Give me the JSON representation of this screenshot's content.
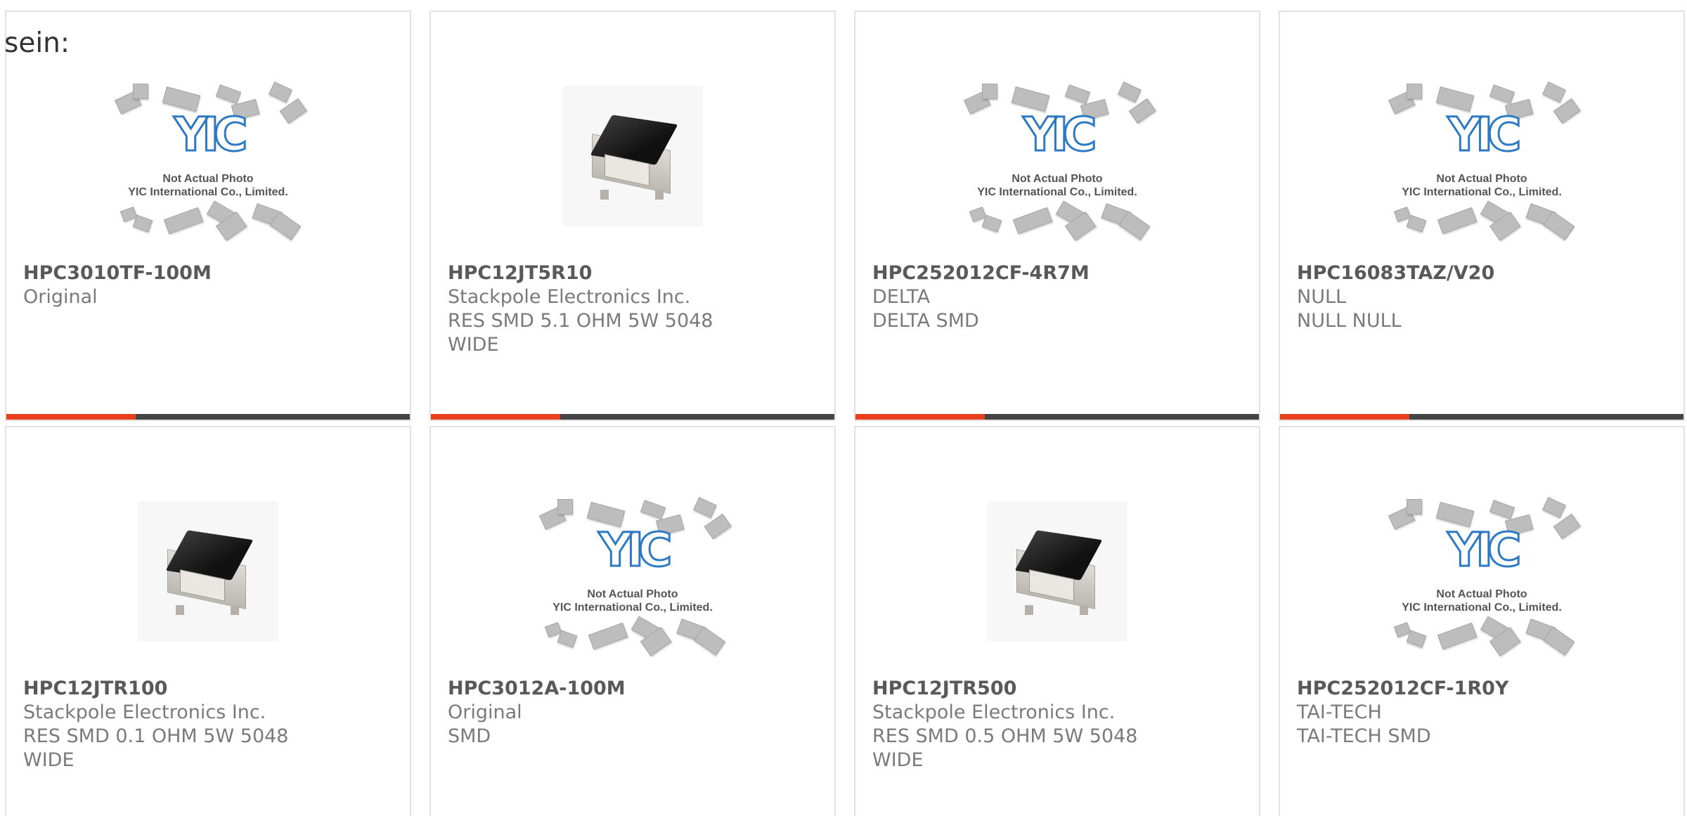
{
  "intro_text": "sein:",
  "placeholder": {
    "logo": "YIC",
    "line1": "Not Actual Photo",
    "line2": "YIC International Co., Limited."
  },
  "colors": {
    "accent_bar": "#e8401c",
    "dark_bar": "#444444",
    "part_number": "#595959",
    "detail_text": "#7a7a7a"
  },
  "products": [
    {
      "part_number": "HPC3010TF-100M",
      "lines": [
        "Original"
      ],
      "image": "placeholder-photo"
    },
    {
      "part_number": "HPC12JT5R10",
      "lines": [
        "Stackpole Electronics Inc.",
        "RES SMD 5.1 OHM 5W 5048",
        "WIDE"
      ],
      "image": "component-photo"
    },
    {
      "part_number": "HPC252012CF-4R7M",
      "lines": [
        "DELTA",
        "DELTA SMD"
      ],
      "image": "placeholder-photo"
    },
    {
      "part_number": "HPC16083TAZ/V20",
      "lines": [
        "NULL",
        "NULL NULL"
      ],
      "image": "placeholder-photo"
    },
    {
      "part_number": "HPC12JTR100",
      "lines": [
        "Stackpole Electronics Inc.",
        "RES SMD 0.1 OHM 5W 5048",
        "WIDE"
      ],
      "image": "component-photo"
    },
    {
      "part_number": "HPC3012A-100M",
      "lines": [
        "Original",
        "SMD"
      ],
      "image": "placeholder-photo"
    },
    {
      "part_number": "HPC12JTR500",
      "lines": [
        "Stackpole Electronics Inc.",
        "RES SMD 0.5 OHM 5W 5048",
        "WIDE"
      ],
      "image": "component-photo"
    },
    {
      "part_number": "HPC252012CF-1R0Y",
      "lines": [
        "TAI-TECH",
        "TAI-TECH SMD"
      ],
      "image": "placeholder-photo"
    }
  ]
}
